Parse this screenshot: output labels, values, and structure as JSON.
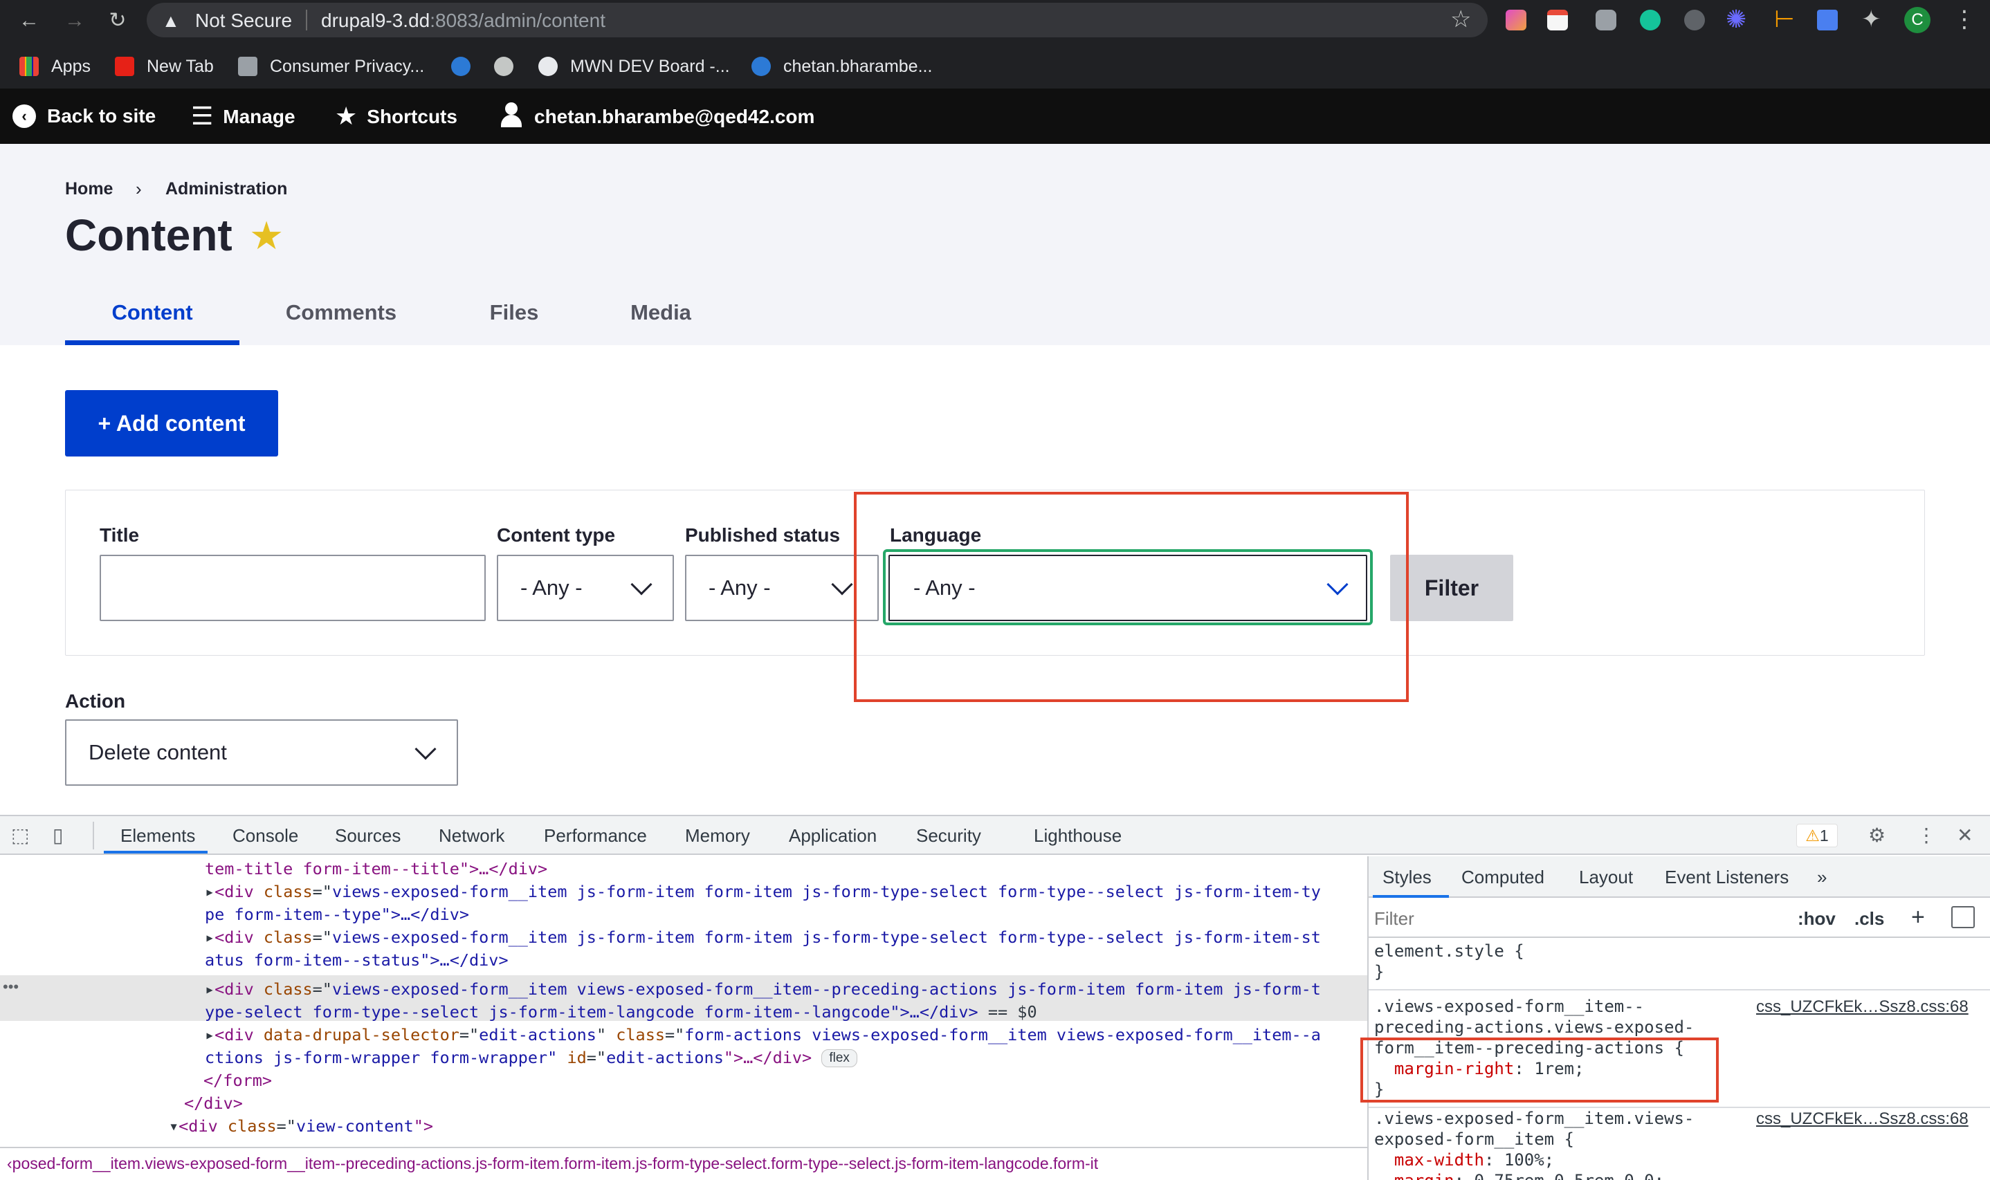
{
  "browser": {
    "security_label": "Not Secure",
    "url_host": "drupal9-3.dd",
    "url_path": ":8083/admin/content",
    "bookmarks": [
      "Apps",
      "New Tab",
      "Consumer Privacy...",
      "MWN DEV Board -...",
      "chetan.bharambe..."
    ],
    "profile_initial": "C"
  },
  "drupal_toolbar": {
    "back": "Back to site",
    "manage": "Manage",
    "shortcuts": "Shortcuts",
    "user": "chetan.bharambe@qed42.com"
  },
  "breadcrumb": {
    "home": "Home",
    "sep": "›",
    "admin": "Administration"
  },
  "page_title": "Content",
  "tabs": [
    "Content",
    "Comments",
    "Files",
    "Media"
  ],
  "add_content": "+ Add content",
  "filters": {
    "title_label": "Title",
    "title_value": "",
    "type_label": "Content type",
    "type_value": "- Any -",
    "status_label": "Published status",
    "status_value": "- Any -",
    "language_label": "Language",
    "language_value": "- Any -",
    "filter_button": "Filter"
  },
  "action": {
    "label": "Action",
    "value": "Delete content"
  },
  "devtools": {
    "tabs": [
      "Elements",
      "Console",
      "Sources",
      "Network",
      "Performance",
      "Memory",
      "Application",
      "Security",
      "Lighthouse"
    ],
    "warning_count": "1",
    "styles_tabs": [
      "Styles",
      "Computed",
      "Layout",
      "Event Listeners",
      "»"
    ],
    "filter_placeholder": "Filter",
    "hov": ":hov",
    "cls": ".cls",
    "breadcrumb": "‹posed-form__item.views-exposed-form__item--preceding-actions.js-form-item.form-item.js-form-type-select.form-type--select.js-form-item-langcode.form-it",
    "dom": {
      "l1": "tem-title form-item--title\">…</div>",
      "l2a": "<div ",
      "l2b": "class",
      "l2c": "=\"",
      "l2d": "views-exposed-form__item js-form-item form-item js-form-type-select form-type--select js-form-item-ty",
      "l3": "pe form-item--type\">…</div>",
      "l4d": "views-exposed-form__item js-form-item form-item js-form-type-select form-type--select js-form-item-st",
      "l5": "atus form-item--status\">…</div>",
      "l6d": "views-exposed-form__item views-exposed-form__item--preceding-actions js-form-item form-item js-form-t",
      "l7": "ype-select form-type--select js-form-item-langcode form-item--langcode\">…</div>",
      "l7b": " == $0",
      "l8a": "data-drupal-selector",
      "l8b": "edit-actions",
      "l8d": "form-actions views-exposed-form__item views-exposed-form__item--a",
      "l9a": "ctions js-form-wrapper form-wrapper\" ",
      "l9b": "id",
      "l9c": "edit-actions",
      "l9d": "\">…</div>",
      "flex": "flex",
      "l10": "</form>",
      "l11": "</div>",
      "l12a": "<div ",
      "l12b": "class",
      "l12c": "view-content"
    },
    "styles": {
      "el_style": "element.style {",
      "close": "}",
      "r1_sel1": ".views-exposed-form__item--",
      "r1_sel2": "preceding-actions.views-exposed-",
      "r1_sel3": "form__item--preceding-actions {",
      "r1_prop": "margin-right",
      "r1_val": "1rem;",
      "r1_src": "css_UZCFkEk…Ssz8.css:68",
      "r2_sel1": ".views-exposed-form__item.views-",
      "r2_sel2": "exposed-form__item {",
      "r2_prop": "max-width",
      "r2_val": "100%;",
      "r2_src": "css_UZCFkEk…Ssz8.css:68",
      "r2_prop2": "margin",
      "r2_val2": "0.75rem 0.5rem 0.0;"
    }
  },
  "colors": {
    "accent": "#003ecc",
    "focus": "#26a769",
    "annotation": "#e0432c"
  }
}
